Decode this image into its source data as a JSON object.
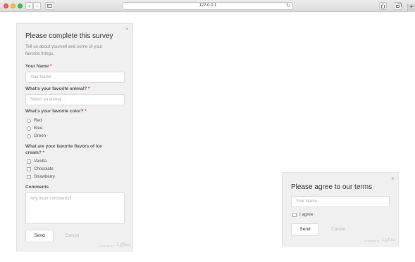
{
  "browser": {
    "url": "127.0.0.1",
    "back_glyph": "‹",
    "forward_glyph": "›",
    "reload_glyph": "↻",
    "new_tab_glyph": "+"
  },
  "survey": {
    "close_glyph": "×",
    "title": "Please complete this survey",
    "subtitle": "Tell us about yourself and some of your favorite things.",
    "name_label": "Your Name",
    "name_placeholder": "Your Name",
    "animal_label": "What's your favorite animal?",
    "animal_placeholder": "Select an animal...",
    "color_label": "What's your favorite color?",
    "colors": [
      "Red",
      "Blue",
      "Green"
    ],
    "flavors_label_line1": "What are your favorite flavors of ice",
    "flavors_label_line2": "cream?",
    "flavors": [
      "Vanilla",
      "Chocolate",
      "Strawberry"
    ],
    "comments_label": "Comments",
    "comments_placeholder": "Any more comments?",
    "required_mark": "*",
    "send_label": "Send",
    "cancel_label": "Cancel",
    "powered_by": "POWERED BY",
    "brand": "Lyfisa"
  },
  "agree": {
    "close_glyph": "×",
    "title": "Please agree to our terms",
    "name_placeholder": "Your Name",
    "agree_label": "I agree",
    "send_label": "Send",
    "cancel_label": "Cancel",
    "powered_by": "POWERED BY",
    "brand": "Lyfisa"
  },
  "colors": {
    "panel_bg": "#f0f0f0",
    "required": "#c0392b"
  }
}
